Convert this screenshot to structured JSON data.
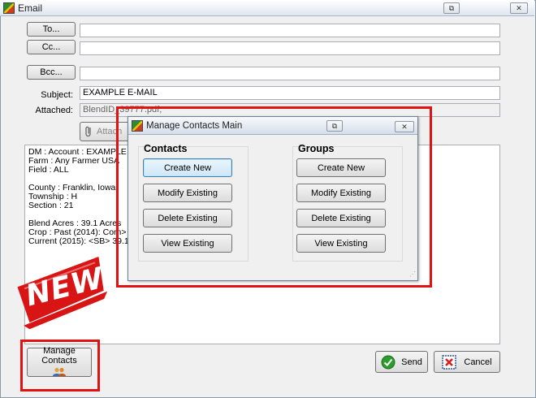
{
  "window": {
    "title": "Email"
  },
  "titlebar_buttons": {
    "restore": "⧉",
    "close": "✕"
  },
  "fields": {
    "to_button": "To...",
    "cc_button": "Cc...",
    "bcc_button": "Bcc...",
    "to_value": "",
    "cc_value": "",
    "bcc_value": "",
    "subject_label": "Subject:",
    "subject_value": "EXAMPLE E-MAIL",
    "attached_label": "Attached:",
    "attached_value": "BlendID_39777.pdf;",
    "attach_button": "Attach"
  },
  "body_lines": [
    "DM : Account : EXAMPLE",
    "Farm : Any Farmer USA",
    "Field : ALL",
    "",
    "County : Franklin, Iowa",
    "Township : H",
    "Section : 21",
    "",
    "Blend Acres : 39.1 Acres",
    "Crop : Past (2014): Corn> 39.13",
    "Current (2015): <SB> 39.13ac"
  ],
  "footer": {
    "manage_contacts": "Manage Contacts",
    "send": "Send",
    "cancel": "Cancel"
  },
  "dialog": {
    "title": "Manage Contacts Main",
    "contacts": {
      "heading": "Contacts",
      "buttons": [
        "Create New",
        "Modify Existing",
        "Delete Existing",
        "View Existing"
      ]
    },
    "groups": {
      "heading": "Groups",
      "buttons": [
        "Create New",
        "Modify Existing",
        "Delete Existing",
        "View Existing"
      ]
    }
  },
  "banner": {
    "text": "NEW"
  },
  "colors": {
    "highlight": "#e01212",
    "send_icon": "#2e9b2e",
    "cancel_icon": "#d82020"
  }
}
